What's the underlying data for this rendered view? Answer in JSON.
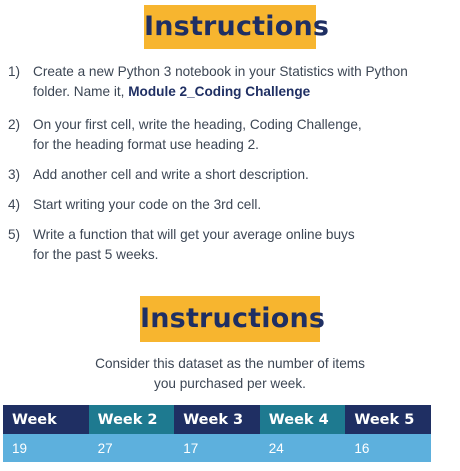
{
  "header": {
    "title": "Instructions"
  },
  "steps": [
    {
      "number": "1)",
      "line1": "Create a new Python 3 notebook in your Statistics with Python",
      "line2_prefix": "folder. Name it, ",
      "line2_bold": "Module 2_Coding Challenge"
    },
    {
      "number": "2)",
      "line1": "On your first cell, write the heading, Coding Challenge,",
      "line2": "for the heading format use heading 2."
    },
    {
      "number": "3)",
      "line1": "Add another cell and write a short description."
    },
    {
      "number": "4)",
      "line1": "Start writing your code on the 3rd cell."
    },
    {
      "number": "5)",
      "line1": "Write a function that will get your average online buys",
      "line2": "for the past 5 weeks."
    }
  ],
  "second_section": {
    "title": "Instructions",
    "description_line1": "Consider this dataset as the number of items",
    "description_line2": "you purchased per week."
  },
  "table": {
    "headers": [
      "Week",
      "Week 2",
      "Week 3",
      "Week 4",
      "Week 5"
    ],
    "values": [
      "19",
      "27",
      "17",
      "24",
      "16"
    ]
  },
  "colors": {
    "banner": "#f7b52f",
    "title_text": "#1f2f63",
    "header_dark": "#1f2f63",
    "header_teal": "#1e7a90",
    "cell_blue": "#5db0dd"
  }
}
